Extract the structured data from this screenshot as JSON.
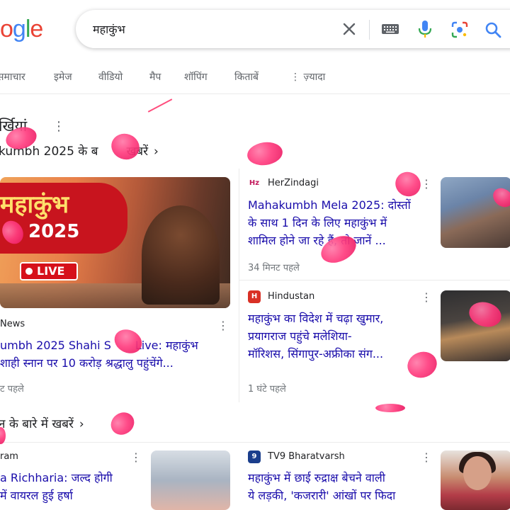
{
  "logo": {
    "text": "ogle",
    "letters": [
      {
        "ch": "o",
        "color": "#ea4335"
      },
      {
        "ch": "g",
        "color": "#4285f4"
      },
      {
        "ch": "l",
        "color": "#34a853"
      },
      {
        "ch": "e",
        "color": "#ea4335"
      }
    ]
  },
  "search": {
    "query": "महाकुंभ"
  },
  "icons": {
    "clear": "close-icon",
    "keyboard": "keyboard-icon",
    "mic": "mic-icon",
    "lens": "lens-icon",
    "search": "search-icon",
    "more": "more-vert-icon"
  },
  "tabs": [
    "समाचार",
    "इमेज",
    "वीडियो",
    "मैप",
    "शॉपिंग",
    "किताबें",
    "⋮ ज़्यादा"
  ],
  "section": {
    "title": "र्खियां",
    "more": "⋮"
  },
  "topics": [
    {
      "label": "kumbh 2025 के ब",
      "tail": "खबरें"
    },
    {
      "label": "न के बारे में खबरें"
    }
  ],
  "articles": [
    {
      "source": "News",
      "headline_lines": [
        "umbh 2025 Shahi S",
        " शाही स्नान पर 10 करोड़ श्रद्धालु पहुंचेंगे..."
      ],
      "headline_live": "Live: महाकुंभ",
      "time": "ट पहले"
    },
    {
      "source": "HerZindagi",
      "source_icon": "Hz",
      "headline_lines": [
        "Mahakumbh Mela 2025: दोस्तों",
        "के साथ 1 दिन के लिए महाकुंभ में",
        "शामिल होने जा रहे हैं, तो जानें ..."
      ],
      "time": "34 मिनट पहले"
    },
    {
      "source": "Hindustan",
      "source_icon": "H",
      "headline_lines": [
        "महाकुंभ का विदेश में चढ़ा खुमार,",
        "प्रयागराज पहुंचे मलेशिया-",
        "मॉरिशस, सिंगापुर-अफ्रीका संग..."
      ],
      "time": "1 घंटे पहले"
    },
    {
      "source": "ram",
      "headline_lines": [
        "a Richharia: जल्द होगी",
        " में वायरल हुई हर्षा"
      ],
      "time": ""
    },
    {
      "source": "TV9 Bharatvarsh",
      "source_icon": "9",
      "headline_lines": [
        "महाकुंभ में छाई रुद्राक्ष बेचने वाली",
        "ये लड़की, 'कजरारी' आंखों पर फिदा"
      ],
      "time": ""
    }
  ],
  "thumbnail": {
    "big_title": "महाकुंभ",
    "big_year": "2025",
    "live_badge": "LIVE"
  },
  "colors": {
    "link": "#1a0dab",
    "petal": "#ff3d7f"
  }
}
